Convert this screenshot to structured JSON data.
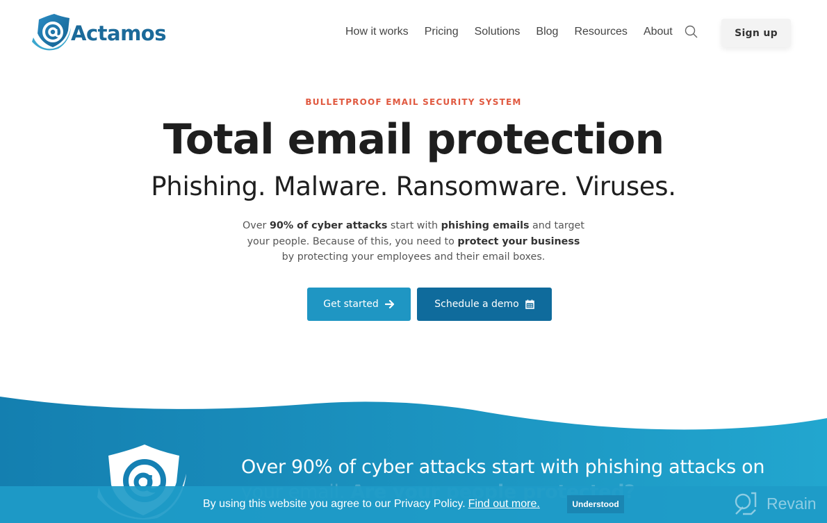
{
  "brand": {
    "name": "Actamos",
    "primary_color": "#1b6a9a",
    "accent_color": "#e0583f",
    "logo_icon": "at-sign-shield-icon"
  },
  "nav": {
    "items": [
      {
        "label": "How it works"
      },
      {
        "label": "Pricing"
      },
      {
        "label": "Solutions"
      },
      {
        "label": "Blog"
      },
      {
        "label": "Resources"
      },
      {
        "label": "About"
      }
    ],
    "search_icon": "search-icon",
    "signup_label": "Sign up"
  },
  "hero": {
    "eyebrow": "BULLETPROOF EMAIL SECURITY SYSTEM",
    "headline": "Total email protection",
    "subline": "Phishing. Malware. Ransomware. Viruses.",
    "lead": [
      {
        "text": "Over ",
        "bold": false
      },
      {
        "text": "90% of cyber attacks",
        "bold": true
      },
      {
        "text": " start with ",
        "bold": false
      },
      {
        "text": "phishing emails",
        "bold": true
      },
      {
        "text": " and target your people. Because of this, you need to ",
        "bold": false
      },
      {
        "text": "protect your business",
        "bold": true
      },
      {
        "text": " by protecting your employees and their email boxes.",
        "bold": false
      }
    ],
    "buttons": {
      "get_started": {
        "label": "Get started",
        "icon": "arrow-right-icon",
        "color": "#1f96c3"
      },
      "schedule_demo": {
        "label": "Schedule a demo",
        "icon": "calendar-icon",
        "color": "#0f6b9c"
      }
    }
  },
  "banner": {
    "line1": "Over 90% of cyber attacks start with phishing attacks on",
    "line2_regular": "your email. ",
    "line2_bold": "Are your people protected?"
  },
  "cookie_bar": {
    "text": "By using this website you agree to our Privacy Policy.",
    "link_label": "Find out more.",
    "button_label": "Understood"
  },
  "watermark": {
    "label": "Revain"
  }
}
